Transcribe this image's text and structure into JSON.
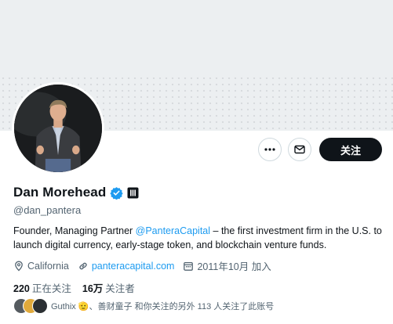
{
  "profile": {
    "display_name": "Dan Morehead",
    "handle": "@dan_pantera",
    "bio_prefix": "Founder, Managing Partner ",
    "bio_mention": "@PanteraCapital",
    "bio_suffix": " – the first investment firm in the U.S. to launch digital currency, early-stage token, and blockchain venture funds.",
    "location": "California",
    "website": "panteracapital.com",
    "joined": "2011年10月 加入",
    "following_count": "220",
    "following_label": "正在关注",
    "followers_count": "16万",
    "followers_label": "关注者",
    "followers_you_know": "Guthix 🫡、善财童子 和你关注的另外 113 人关注了此账号"
  },
  "actions": {
    "more_icon": "more-horizontal-icon",
    "message_icon": "envelope-icon",
    "follow_label": "关注"
  },
  "badges": {
    "verified_color": "#1d9bf0",
    "affiliate_logo": "pantera-logo"
  },
  "colors": {
    "link": "#1d9bf0",
    "text": "#0f1419",
    "secondary": "#536471",
    "banner": "#eceff1"
  }
}
